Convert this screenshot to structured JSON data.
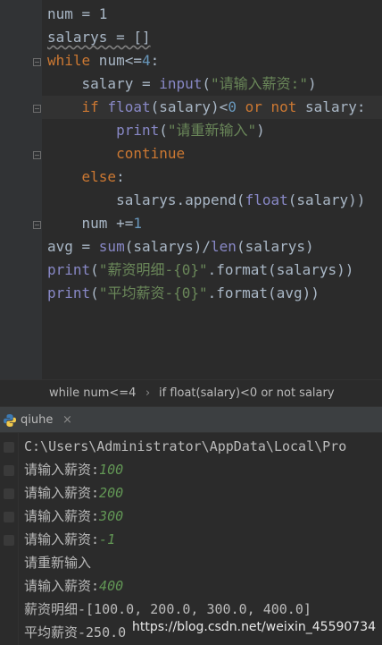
{
  "editor": {
    "lines": [
      "num = 1",
      "salarys = []",
      "while num<=4:",
      "    salary = input(\"请输入薪资:\")",
      "    if float(salary)<0 or not salary:",
      "        print(\"请重新输入\")",
      "        continue",
      "    else:",
      "        salarys.append(float(salary))",
      "    num +=1",
      "avg = sum(salarys)/len(salarys)",
      "print(\"薪资明细-{0}\".format(salarys))",
      "print(\"平均薪资-{0}\".format(avg))"
    ]
  },
  "breadcrumb": {
    "item1": "while num<=4",
    "separator": "›",
    "item2": "if float(salary)<0 or not salary"
  },
  "run_tab": {
    "label": "qiuhe",
    "close": "×"
  },
  "console": {
    "path": "C:\\Users\\Administrator\\AppData\\Local\\Pro",
    "lines": [
      {
        "prompt": "请输入薪资:",
        "input": "100"
      },
      {
        "prompt": "请输入薪资:",
        "input": "200"
      },
      {
        "prompt": "请输入薪资:",
        "input": "300"
      },
      {
        "prompt": "请输入薪资:",
        "input": "-1"
      },
      {
        "prompt": "请重新输入",
        "input": ""
      },
      {
        "prompt": "请输入薪资:",
        "input": "400"
      },
      {
        "prompt": "薪资明细-[100.0, 200.0, 300.0, 400.0]",
        "input": ""
      },
      {
        "prompt": "平均薪资-250.0",
        "input": ""
      }
    ]
  },
  "watermark": "https://blog.csdn.net/weixin_45590734",
  "colors": {
    "background": "#2b2b2b",
    "keyword": "#cc7832",
    "builtin": "#8888c6",
    "string": "#6a8759",
    "number": "#6897bb",
    "console_input": "#629755"
  }
}
